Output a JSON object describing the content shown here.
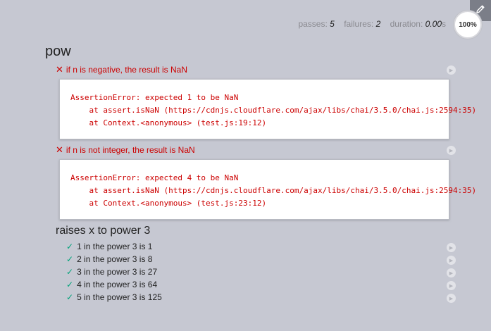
{
  "progress": {
    "label": "100%"
  },
  "stats": {
    "passes_label": "passes:",
    "passes": "5",
    "failures_label": "failures:",
    "failures": "2",
    "duration_label": "duration:",
    "duration": "0.00",
    "duration_unit": "s"
  },
  "suite": {
    "title": "pow",
    "failed_tests": [
      {
        "title": "if n is negative, the result is NaN",
        "mark": "✕",
        "error": [
          "AssertionError: expected 1 to be NaN",
          "    at assert.isNaN (https://cdnjs.cloudflare.com/ajax/libs/chai/3.5.0/chai.js:2594:35)",
          "    at Context.<anonymous> (test.js:19:12)"
        ]
      },
      {
        "title": "if n is not integer, the result is NaN",
        "mark": "✕",
        "error": [
          "AssertionError: expected 4 to be NaN",
          "    at assert.isNaN (https://cdnjs.cloudflare.com/ajax/libs/chai/3.5.0/chai.js:2594:35)",
          "    at Context.<anonymous> (test.js:23:12)"
        ]
      }
    ],
    "sub_suite": {
      "title": "raises x to power 3",
      "tests": [
        {
          "title": "1 in the power 3 is 1",
          "mark": "✓"
        },
        {
          "title": "2 in the power 3 is 8",
          "mark": "✓"
        },
        {
          "title": "3 in the power 3 is 27",
          "mark": "✓"
        },
        {
          "title": "4 in the power 3 is 64",
          "mark": "✓"
        },
        {
          "title": "5 in the power 3 is 125",
          "mark": "✓"
        }
      ]
    }
  },
  "icons": {
    "edit": "pencil-icon",
    "replay": "replay-icon"
  },
  "colors": {
    "background": "#c6c8d2",
    "fail": "#cc0000",
    "pass": "#00a37a",
    "edit_button": "#7b7e88"
  }
}
